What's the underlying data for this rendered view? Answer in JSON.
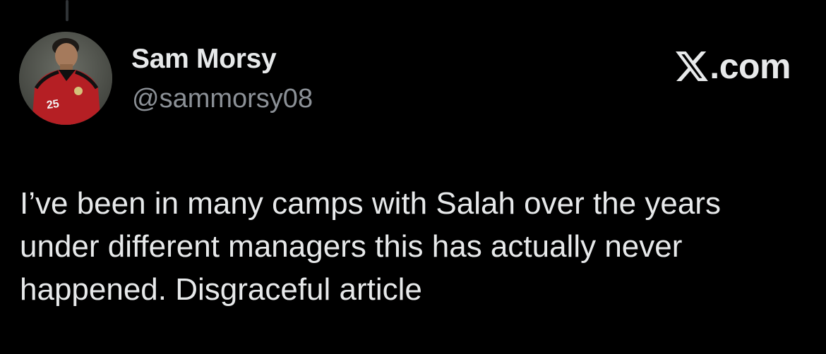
{
  "tweet": {
    "author": {
      "name": "Sam Morsy",
      "handle": "@sammorsy08",
      "avatar": {
        "icon": "profile-photo",
        "jersey_number": "25"
      }
    },
    "brand": {
      "icon": "x-logo",
      "text": ".com"
    },
    "text": "I’ve been in many camps with Salah over the years under different managers this has actually never happened. Disgraceful article"
  },
  "colors": {
    "background": "#000000",
    "primary_text": "#e7e9ea",
    "secondary_text": "#8b9096",
    "thread_line": "#2f3336"
  }
}
